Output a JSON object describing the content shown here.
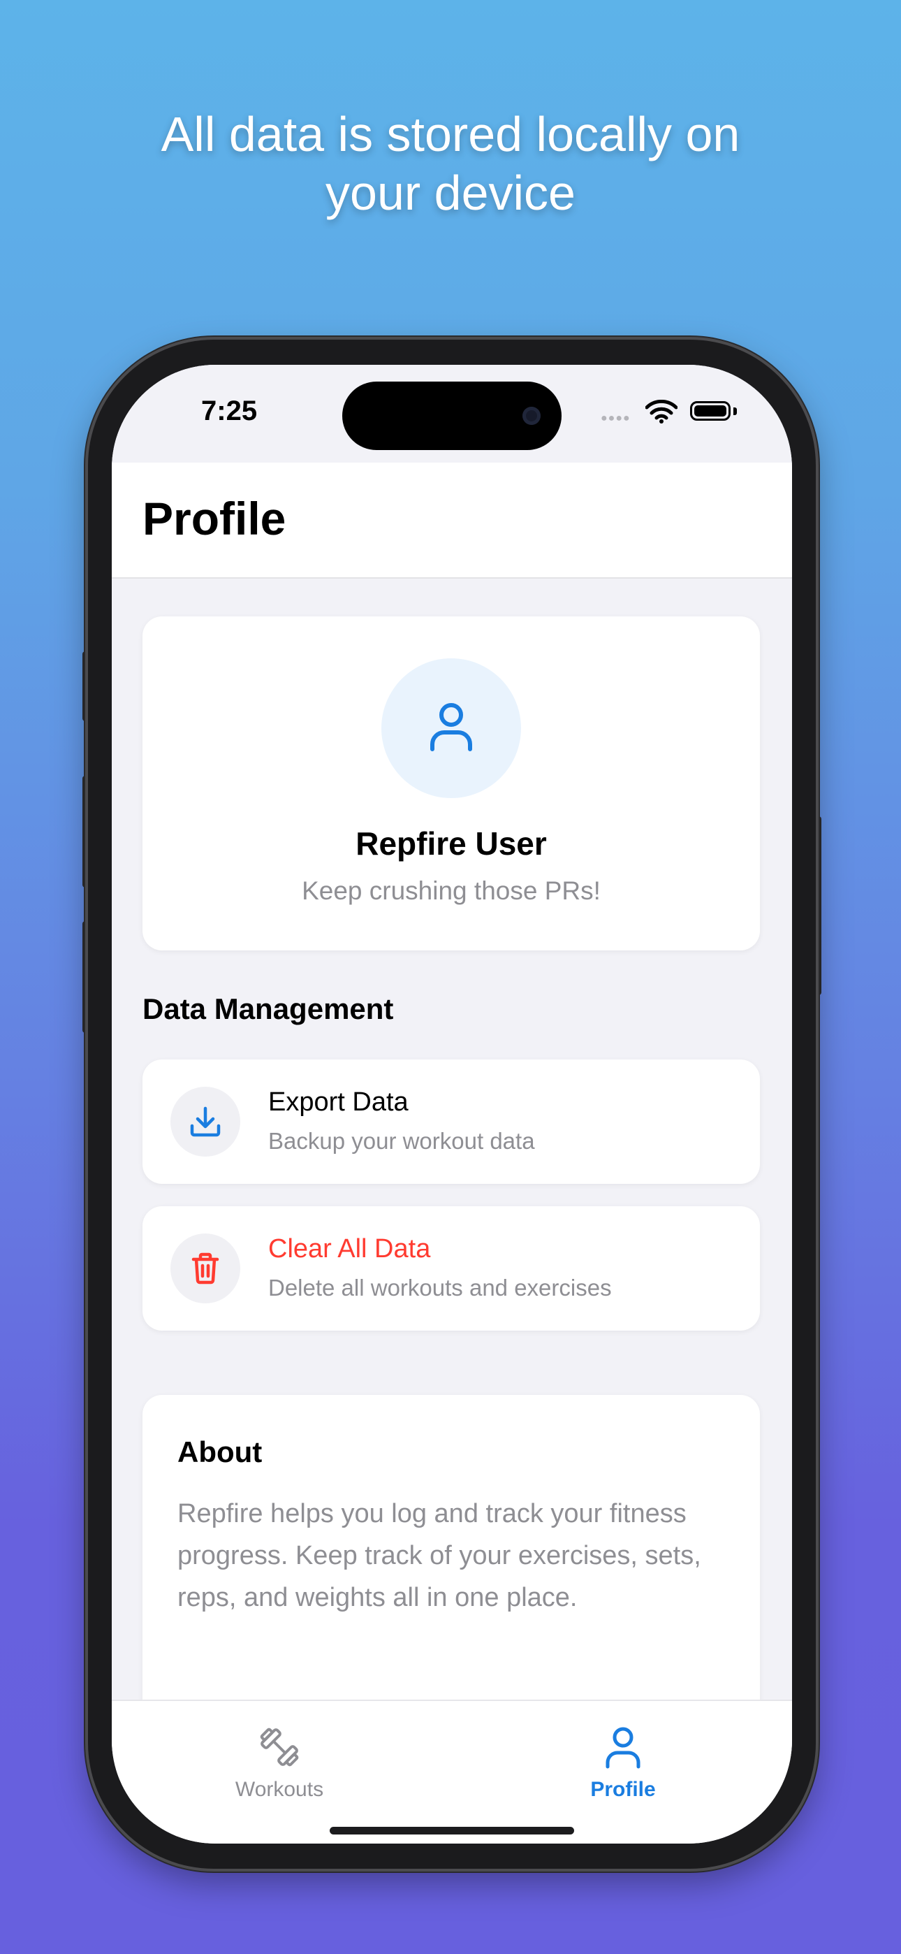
{
  "headline": {
    "line1": "All data is stored locally on",
    "line2": "your device"
  },
  "status_bar": {
    "time": "7:25",
    "icons": [
      "signal-dots-icon",
      "wifi-icon",
      "battery-icon"
    ]
  },
  "nav": {
    "title": "Profile"
  },
  "profile": {
    "avatar_icon": "person-icon",
    "name": "Repfire User",
    "tagline": "Keep crushing those PRs!"
  },
  "data_management": {
    "heading": "Data Management",
    "items": [
      {
        "icon": "download-icon",
        "title": "Export Data",
        "subtitle": "Backup your workout data"
      },
      {
        "icon": "trash-icon",
        "title": "Clear All Data",
        "subtitle": "Delete all workouts and exercises"
      }
    ]
  },
  "about": {
    "title": "About",
    "body": "Repfire helps you log and track your fitness progress. Keep track of your exercises, sets, reps, and weights all in one place."
  },
  "tab_bar": {
    "tabs": [
      {
        "label": "Workouts",
        "icon": "dumbbell-icon",
        "selected": false
      },
      {
        "label": "Profile",
        "icon": "person-icon",
        "selected": true
      }
    ]
  },
  "colors": {
    "accent": "#1a7de0",
    "danger": "#ff3b30",
    "secondary_text": "#8e8e93",
    "background_top": "#5db3e9",
    "background_bottom": "#6760de"
  }
}
